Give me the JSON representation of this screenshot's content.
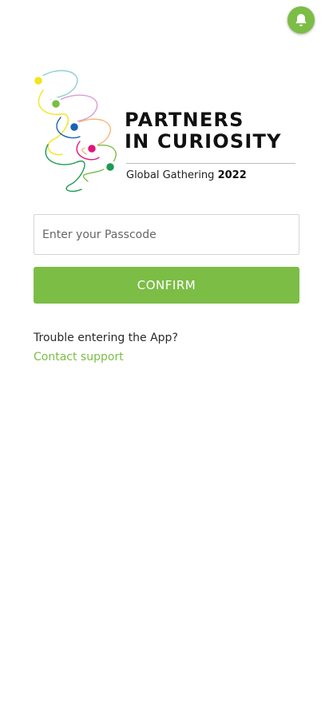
{
  "header": {
    "notification_icon": "bell-icon"
  },
  "logo": {
    "title_line1": "PARTNERS",
    "title_line2": "IN CURIOSITY",
    "subtitle_prefix": "Global Gathering",
    "subtitle_year": "2022",
    "mark_colors": [
      "#f2e51a",
      "#7cbd46",
      "#1b62b0",
      "#e0147a",
      "#1f9b52",
      "#f5b878",
      "#d99bd6",
      "#8fd0d0"
    ]
  },
  "login": {
    "passcode_placeholder": "Enter your Passcode",
    "passcode_value": "",
    "confirm_label": "CONFIRM"
  },
  "help": {
    "trouble_text": "Trouble entering the App?",
    "support_link": "Contact support"
  },
  "colors": {
    "accent": "#7cbd46",
    "background": "#ffffff"
  }
}
